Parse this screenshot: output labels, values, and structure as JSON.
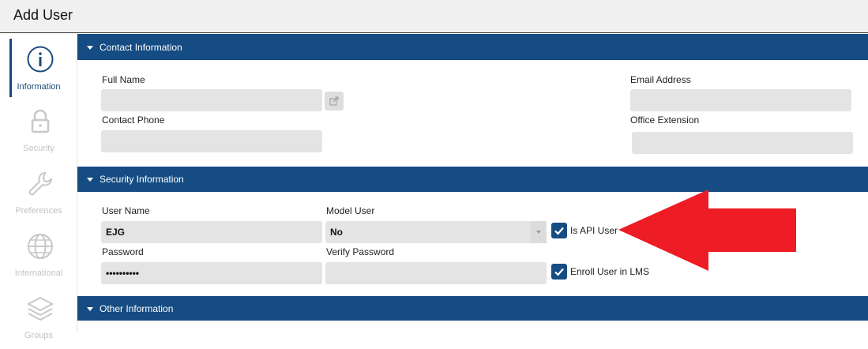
{
  "window": {
    "title": "Add User"
  },
  "nav": {
    "items": [
      {
        "label": "Information",
        "icon": "info-icon"
      },
      {
        "label": "Security",
        "icon": "lock-icon"
      },
      {
        "label": "Preferences",
        "icon": "wrench-icon"
      },
      {
        "label": "International",
        "icon": "globe-icon"
      },
      {
        "label": "Groups",
        "icon": "layers-icon"
      }
    ]
  },
  "sections": {
    "contact": {
      "title": "Contact Information",
      "full_name_label": "Full Name",
      "full_name_value": "",
      "email_label": "Email Address",
      "email_value": "",
      "phone_label": "Contact Phone",
      "phone_value": "",
      "extension_label": "Office Extension",
      "extension_value": ""
    },
    "security": {
      "title": "Security Information",
      "username_label": "User Name",
      "username_value": "EJG",
      "model_user_label": "Model User",
      "model_user_value": "No",
      "password_label": "Password",
      "password_value": "••••••••••",
      "verify_password_label": "Verify Password",
      "verify_password_value": "",
      "api_user_label": "Is API User",
      "api_user_checked": true,
      "enroll_lms_label": "Enroll User in LMS",
      "enroll_lms_checked": true
    },
    "other": {
      "title": "Other Information"
    }
  },
  "colors": {
    "section_header": "#154c83",
    "checkbox": "#154c83",
    "annotation_arrow": "#ee1c25",
    "nav_active": "#1a4a7e",
    "nav_inactive": "#c3c3c3"
  }
}
